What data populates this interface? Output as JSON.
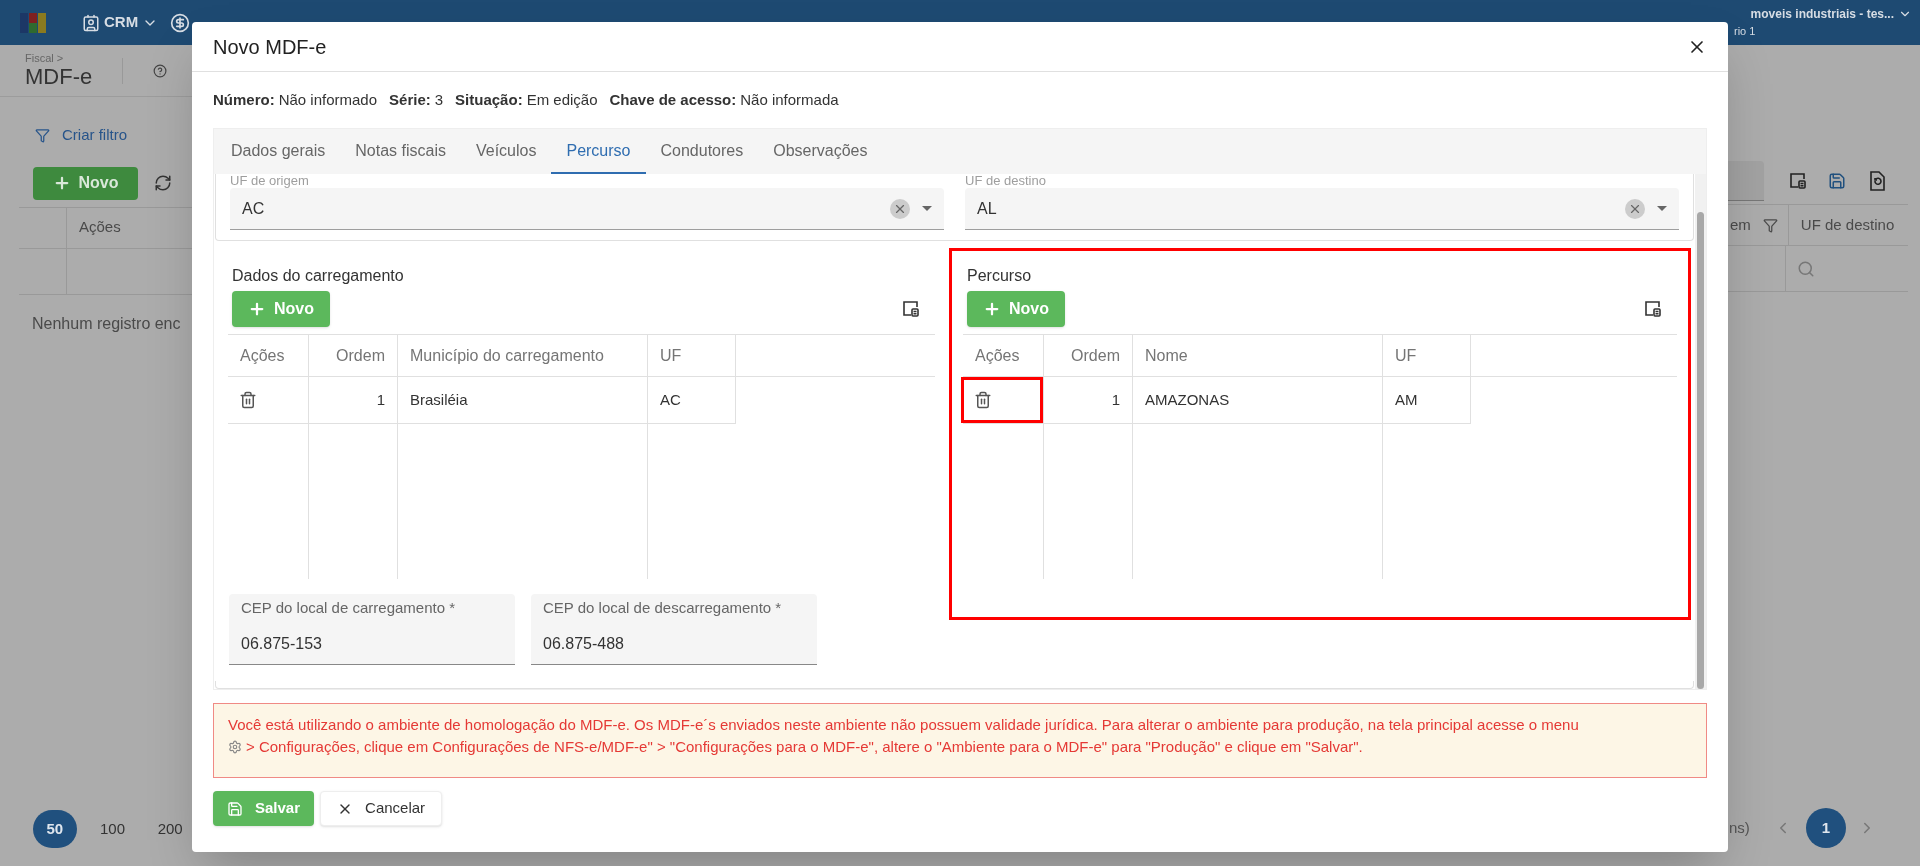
{
  "app_bar": {
    "module": "CRM",
    "company": "moveis industriais - tes...",
    "user": "rio 1"
  },
  "page": {
    "breadcrumb": "Fiscal >",
    "title": "MDF-e",
    "filter_link": "Criar filtro",
    "new_button": "Novo",
    "columns_left": [
      "Ações"
    ],
    "columns_right": [
      "em",
      "UF de destino"
    ],
    "empty_message": "Nenhum registro enc",
    "page_sizes": [
      {
        "label": "50",
        "selected": true
      },
      {
        "label": "100",
        "selected": false
      },
      {
        "label": "200",
        "selected": false
      }
    ],
    "page_info": "ns)",
    "pages": [
      {
        "label": "1",
        "selected": true
      }
    ]
  },
  "dialog": {
    "title": "Novo MDF-e",
    "info": [
      {
        "label": "Número:",
        "value": "Não informado"
      },
      {
        "label": "Série:",
        "value": "3"
      },
      {
        "label": "Situação:",
        "value": "Em edição"
      },
      {
        "label": "Chave de acesso:",
        "value": "Não informada"
      }
    ],
    "tabs": [
      {
        "label": "Dados gerais",
        "selected": false
      },
      {
        "label": "Notas fiscais",
        "selected": false
      },
      {
        "label": "Veículos",
        "selected": false
      },
      {
        "label": "Percurso",
        "selected": true
      },
      {
        "label": "Condutores",
        "selected": false
      },
      {
        "label": "Observações",
        "selected": false
      }
    ],
    "uf_fields": [
      {
        "label": "UF de origem",
        "value": "AC"
      },
      {
        "label": "UF de destino",
        "value": "AL"
      }
    ],
    "sections": [
      {
        "title": "Dados do carregamento",
        "new_button": "Novo",
        "highlighted": false,
        "columns": [
          "Ações",
          "Ordem",
          "Município do carregamento",
          "UF"
        ],
        "rows": [
          {
            "order": "1",
            "name": "Brasiléia",
            "uf": "AC",
            "action_highlighted": false
          }
        ]
      },
      {
        "title": "Percurso",
        "new_button": "Novo",
        "highlighted": true,
        "columns": [
          "Ações",
          "Ordem",
          "Nome",
          "UF"
        ],
        "rows": [
          {
            "order": "1",
            "name": "AMAZONAS",
            "uf": "AM",
            "action_highlighted": true
          }
        ]
      }
    ],
    "cep_fields": [
      {
        "label": "CEP do local de carregamento *",
        "value": "06.875-153"
      },
      {
        "label": "CEP do local de descarregamento *",
        "value": "06.875-488"
      }
    ],
    "warning": {
      "text_before": "Você está utilizando o ambiente de homologação do MDF-e. Os MDF-e´s enviados neste ambiente não possuem validade jurídica. Para alterar o ambiente para produção, na tela principal acesse o menu",
      "text_after": "> Configurações, clique em Configurações de NFS-e/MDF-e\" > \"Configurações para o MDF-e\", altere o \"Ambiente para o MDF-e\" para \"Produção\" e clique em \"Salvar\"."
    },
    "buttons": [
      {
        "kind": "save",
        "label": "Salvar"
      },
      {
        "kind": "cancel",
        "label": "Cancelar"
      }
    ]
  }
}
